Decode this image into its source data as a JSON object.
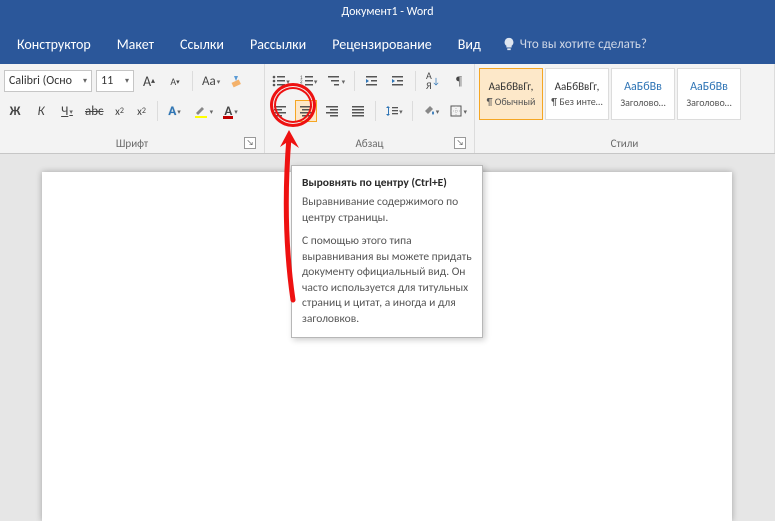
{
  "title": "Документ1 - Word",
  "menu": {
    "constructor": "Конструктор",
    "layout": "Макет",
    "links": "Ссылки",
    "mailings": "Рассылки",
    "review": "Рецензирование",
    "view": "Вид",
    "tell_me": "Что вы хотите сделать?"
  },
  "font": {
    "name": "Calibri (Осно",
    "size": "11",
    "group_label": "Шрифт"
  },
  "para": {
    "group_label": "Абзац"
  },
  "styles": {
    "group_label": "Стили",
    "items": [
      {
        "preview": "АаБбВвГг,",
        "label": "¶ Обычный",
        "accent": false
      },
      {
        "preview": "АаБбВвГг,",
        "label": "¶ Без инте…",
        "accent": false
      },
      {
        "preview": "АаБбВв",
        "label": "Заголово…",
        "accent": true
      },
      {
        "preview": "АаБбВв",
        "label": "Заголово…",
        "accent": true
      }
    ]
  },
  "tooltip": {
    "title": "Выровнять по центру (Ctrl+E)",
    "p1": "Выравнивание содержимого по центру страницы.",
    "p2": "С помощью этого типа выравнивания вы можете придать документу официальный вид. Он часто используется для титульных страниц и цитат, а иногда и для заголовков."
  }
}
